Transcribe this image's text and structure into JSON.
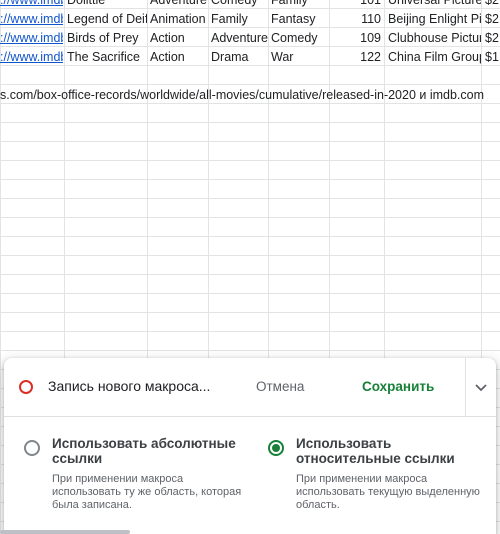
{
  "sheet": {
    "rows": [
      {
        "link": "://www.imdb",
        "title": "Dolittle",
        "genre1": "Adventure",
        "genre2": "Comedy",
        "genre3": "Family",
        "runtime": "101",
        "studio": "Universal Picture",
        "gross": "$2"
      },
      {
        "link": "://www.imdb",
        "title": "Legend of Deifi",
        "genre1": "Animation",
        "genre2": "Family",
        "genre3": "Fantasy",
        "runtime": "110",
        "studio": "Beijing Enlight Pi",
        "gross": "$2"
      },
      {
        "link": "://www.imdb",
        "title": "Birds of Prey",
        "genre1": "Action",
        "genre2": "Adventure",
        "genre3": "Comedy",
        "runtime": "109",
        "studio": "Clubhouse Pictur",
        "gross": "$2"
      },
      {
        "link": "://www.imdb",
        "title": "The Sacrifice",
        "genre1": "Action",
        "genre2": "Drama",
        "genre3": "War",
        "runtime": "122",
        "studio": "China Film Group",
        "gross": "$1"
      }
    ],
    "source_note": "s.com/box-office-records/worldwide/all-movies/cumulative/released-in-2020 и imdb.com"
  },
  "macro_panel": {
    "title": "Запись нового макроса...",
    "cancel_label": "Отмена",
    "save_label": "Сохранить",
    "options": {
      "absolute": {
        "title": "Использовать абсолютные ссылки",
        "description": "При применении макроса использовать ту же область, которая была записана.",
        "selected": false
      },
      "relative": {
        "title": "Использовать относительные ссылки",
        "description": "При применении макроса использовать текущую выделенную область.",
        "selected": true
      }
    }
  },
  "colors": {
    "accent_green": "#188038",
    "record_red": "#d93025",
    "link_blue": "#1155cc"
  },
  "icons": {
    "record": "record-circle-icon",
    "expand": "chevron-down-icon"
  }
}
